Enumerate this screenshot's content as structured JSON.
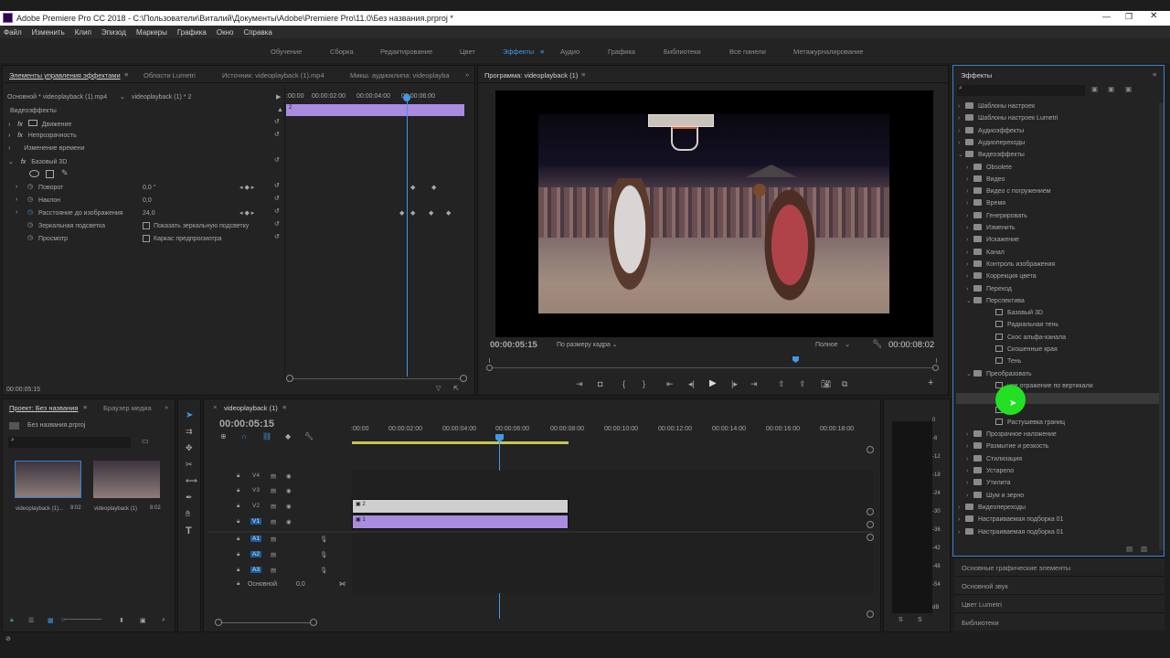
{
  "title": "Adobe Premiere Pro CC 2018 - C:\\Пользователи\\Виталий\\Документы\\Adobe\\Premiere Pro\\11.0\\Без названия.prproj *",
  "menu": [
    "Файл",
    "Изменить",
    "Клип",
    "Эпизод",
    "Маркеры",
    "Графика",
    "Окно",
    "Справка"
  ],
  "workspaces": [
    "Обучение",
    "Сборка",
    "Редактирование",
    "Цвет",
    "Эффекты",
    "Аудио",
    "Графика",
    "Библиотеки",
    "Все панели",
    "Метажурналирование"
  ],
  "ec": {
    "tabs": [
      "Элементы управления эффектами",
      "Области Lumetri",
      "Источник: videoplayback (1).mp4",
      "Микш. аудиоклипа: videoplayba"
    ],
    "master": "Основной * videoplayback (1).mp4",
    "seq": "videoplayback (1) * 2",
    "section": "Видеоэффекты",
    "motion": "Движение",
    "opacity": "Непрозрачность",
    "time": "Изменение времени",
    "basic3d": "Базовый 3D",
    "rotate": "Поворот",
    "rotate_v": "0,0 °",
    "tilt": "Наклон",
    "tilt_v": "0,0",
    "dist": "Расстояние до изображения",
    "dist_v": "24,0",
    "mirror": "Зеркальная подсветка",
    "mirror_cb": "Показать зеркальную подсветку",
    "preview": "Просмотр",
    "preview_cb": "Каркас предпросмотра",
    "ruler": [
      ":00:00",
      "00:00:02:00",
      "00:00:04:00",
      "00:00:06:00"
    ],
    "clip": "2",
    "tc": "00:00:05:15"
  },
  "prog": {
    "tab": "Программа: videoplayback (1)",
    "tc": "00:00:05:15",
    "fit": "По размеру кадра",
    "quality": "Полное",
    "dur": "00:00:08:02"
  },
  "project": {
    "tabs": [
      "Проект: Без названия",
      "Браузер медиа"
    ],
    "file": "Без названия.prproj",
    "items": [
      {
        "name": "videoplayback (1)...",
        "dur": "8:02"
      },
      {
        "name": "videoplayback (1)",
        "dur": "8:02"
      }
    ]
  },
  "tl": {
    "tab": "videoplayback (1)",
    "tc": "00:00:05:15",
    "ruler": [
      ":00:00",
      "00:00:02:00",
      "00:00:04:00",
      "00:00:06:00",
      "00:00:08:00",
      "00:00:10:00",
      "00:00:12:00",
      "00:00:14:00",
      "00:00:16:00",
      "00:00:18:00"
    ],
    "vtracks": [
      "V4",
      "V3",
      "V2",
      "V1"
    ],
    "atracks": [
      "A1",
      "A2",
      "A3"
    ],
    "src_v": "V1",
    "src_a": "A1",
    "master": "Основной",
    "master_v": "0,0",
    "clip_v2": "2",
    "clip_v1": "1",
    "ms": [
      "M",
      "S"
    ]
  },
  "meter": {
    "scale": [
      "0",
      "-6",
      "-12",
      "-18",
      "-24",
      "-30",
      "-36",
      "-42",
      "-48",
      "-54",
      "dB"
    ],
    "s": [
      "S",
      "S"
    ]
  },
  "effects": {
    "title": "Эффекты",
    "tree": [
      {
        "t": "Шаблоны настроек",
        "l": 0,
        "k": "f"
      },
      {
        "t": "Шаблоны настроек Lumetri",
        "l": 0,
        "k": "f"
      },
      {
        "t": "Аудиоэффекты",
        "l": 0,
        "k": "f"
      },
      {
        "t": "Аудиопереходы",
        "l": 0,
        "k": "f"
      },
      {
        "t": "Видеоэффекты",
        "l": 0,
        "k": "f",
        "open": true
      },
      {
        "t": "Obsolete",
        "l": 1,
        "k": "f"
      },
      {
        "t": "Видео",
        "l": 1,
        "k": "f"
      },
      {
        "t": "Видео с погружением",
        "l": 1,
        "k": "f"
      },
      {
        "t": "Время",
        "l": 1,
        "k": "f"
      },
      {
        "t": "Генерировать",
        "l": 1,
        "k": "f"
      },
      {
        "t": "Изменить",
        "l": 1,
        "k": "f"
      },
      {
        "t": "Искажение",
        "l": 1,
        "k": "f"
      },
      {
        "t": "Канал",
        "l": 1,
        "k": "f"
      },
      {
        "t": "Контроль изображения",
        "l": 1,
        "k": "f"
      },
      {
        "t": "Коррекция цвета",
        "l": 1,
        "k": "f"
      },
      {
        "t": "Переход",
        "l": 1,
        "k": "f"
      },
      {
        "t": "Перспектива",
        "l": 1,
        "k": "f",
        "open": true
      },
      {
        "t": "Базовый 3D",
        "l": 2,
        "k": "e"
      },
      {
        "t": "Радиальная тень",
        "l": 2,
        "k": "e"
      },
      {
        "t": "Скос альфа-канала",
        "l": 2,
        "k": "e"
      },
      {
        "t": "Скошенные края",
        "l": 2,
        "k": "e"
      },
      {
        "t": "Тень",
        "l": 2,
        "k": "e"
      },
      {
        "t": "Преобразовать",
        "l": 1,
        "k": "f",
        "open": true
      },
      {
        "t": "ное отражение по вертикали",
        "l": 2,
        "k": "e"
      },
      {
        "t": "ное отражение по горизонтали",
        "l": 2,
        "k": "e",
        "sel": true
      },
      {
        "t": "",
        "l": 2,
        "k": "e"
      },
      {
        "t": "Растушевка границ",
        "l": 2,
        "k": "e"
      },
      {
        "t": "Прозрачное наложение",
        "l": 1,
        "k": "f"
      },
      {
        "t": "Размытие и резкость",
        "l": 1,
        "k": "f"
      },
      {
        "t": "Стилизация",
        "l": 1,
        "k": "f"
      },
      {
        "t": "Устарело",
        "l": 1,
        "k": "f"
      },
      {
        "t": "Утилита",
        "l": 1,
        "k": "f"
      },
      {
        "t": "Шум и зерно",
        "l": 1,
        "k": "f"
      },
      {
        "t": "Видеопереходы",
        "l": 0,
        "k": "f"
      },
      {
        "t": "Настраиваемая подборка 01",
        "l": 0,
        "k": "f"
      },
      {
        "t": "Настраиваемая подборка 01",
        "l": 0,
        "k": "f"
      }
    ]
  },
  "bottom_panels": [
    "Основные графические элементы",
    "Основной звук",
    "Цвет Lumetri",
    "Библиотеки"
  ],
  "colors": {
    "accent": "#2d8ceb",
    "clip": "#a98be0",
    "cursor": "#23e023"
  }
}
